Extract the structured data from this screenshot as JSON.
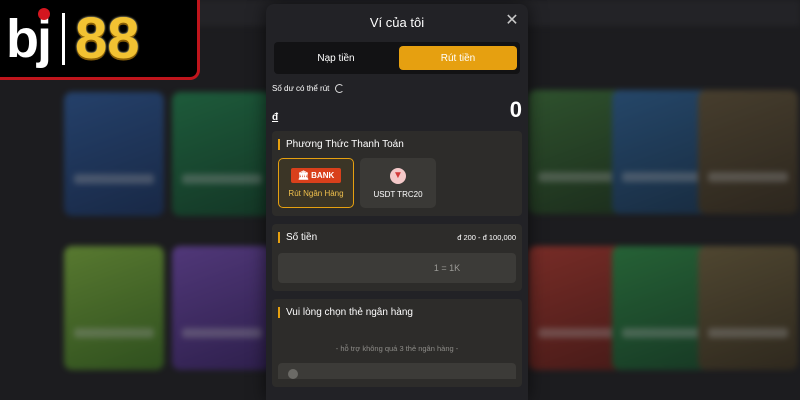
{
  "logo": {
    "text_bj": "bj",
    "text_88": "88"
  },
  "modal": {
    "title": "Ví của tôi",
    "close_icon": "close-icon",
    "tabs": [
      {
        "label": "Nạp tiền",
        "active": false
      },
      {
        "label": "Rút tiền",
        "active": true
      }
    ]
  },
  "balance": {
    "label": "Số dư có thể rút",
    "currency_symbol": "đ",
    "value": "0"
  },
  "payment_methods": {
    "title": "Phương Thức Thanh Toán",
    "items": [
      {
        "label": "Rút Ngân Hàng",
        "icon_text": "BANK",
        "icon": "bank-icon",
        "selected": true
      },
      {
        "label": "USDT TRC20",
        "icon": "tron-icon",
        "selected": false
      }
    ]
  },
  "amount": {
    "title": "Số tiền",
    "range": "đ 200 - đ 100,000",
    "placeholder": "1 = 1K"
  },
  "bank_card": {
    "title": "Vui lòng chọn thẻ ngân hàng",
    "hint": "- hỗ trợ không quá 3 thẻ ngân hàng -"
  },
  "colors": {
    "accent": "#e6a010",
    "brand_red": "#c0151c",
    "logo_gold": "#f2c232"
  }
}
